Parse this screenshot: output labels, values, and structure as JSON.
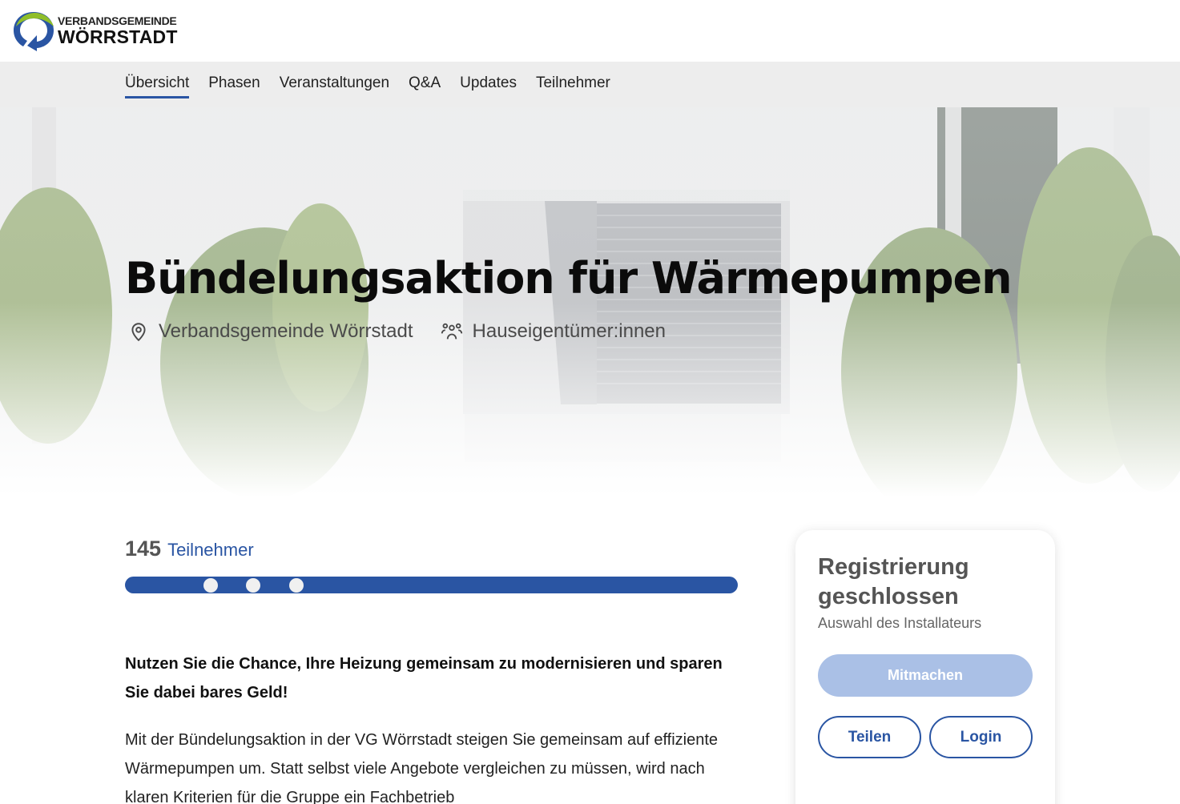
{
  "brand": {
    "line1": "VERBANDSGEMEINDE",
    "line2": "WÖRRSTADT",
    "colors": {
      "green": "#8fbe2a",
      "blue": "#2a55a3"
    }
  },
  "nav": {
    "items": [
      {
        "label": "Übersicht",
        "active": true
      },
      {
        "label": "Phasen"
      },
      {
        "label": "Veranstaltungen"
      },
      {
        "label": "Q&A"
      },
      {
        "label": "Updates"
      },
      {
        "label": "Teilnehmer"
      }
    ]
  },
  "hero": {
    "title": "Bündelungsaktion für Wärmepumpen",
    "location": "Verbandsgemeinde Wörrstadt",
    "audience": "Hauseigentümer:innen",
    "location_icon": "location-pin-icon",
    "audience_icon": "people-icon"
  },
  "participants": {
    "count": "145",
    "label": "Teilnehmer"
  },
  "content": {
    "lead": "Nutzen Sie die Chance, Ihre Heizung gemeinsam zu modernisieren und sparen Sie dabei bares Geld!",
    "paragraph": "Mit der Bündelungsaktion in der VG Wörrstadt steigen Sie gemeinsam auf effiziente Wärmepumpen um. Statt selbst viele Angebote vergleichen zu müssen, wird nach klaren Kriterien für die Gruppe ein Fachbetrieb"
  },
  "card": {
    "title": "Registrierung geschlossen",
    "subtitle": "Auswahl des Installateurs",
    "primary_button": "Mitmachen",
    "share_button": "Teilen",
    "login_button": "Login"
  },
  "colors": {
    "accent": "#2a55a3",
    "button_disabled": "#aac0e6",
    "nav_bg": "#ededed"
  }
}
